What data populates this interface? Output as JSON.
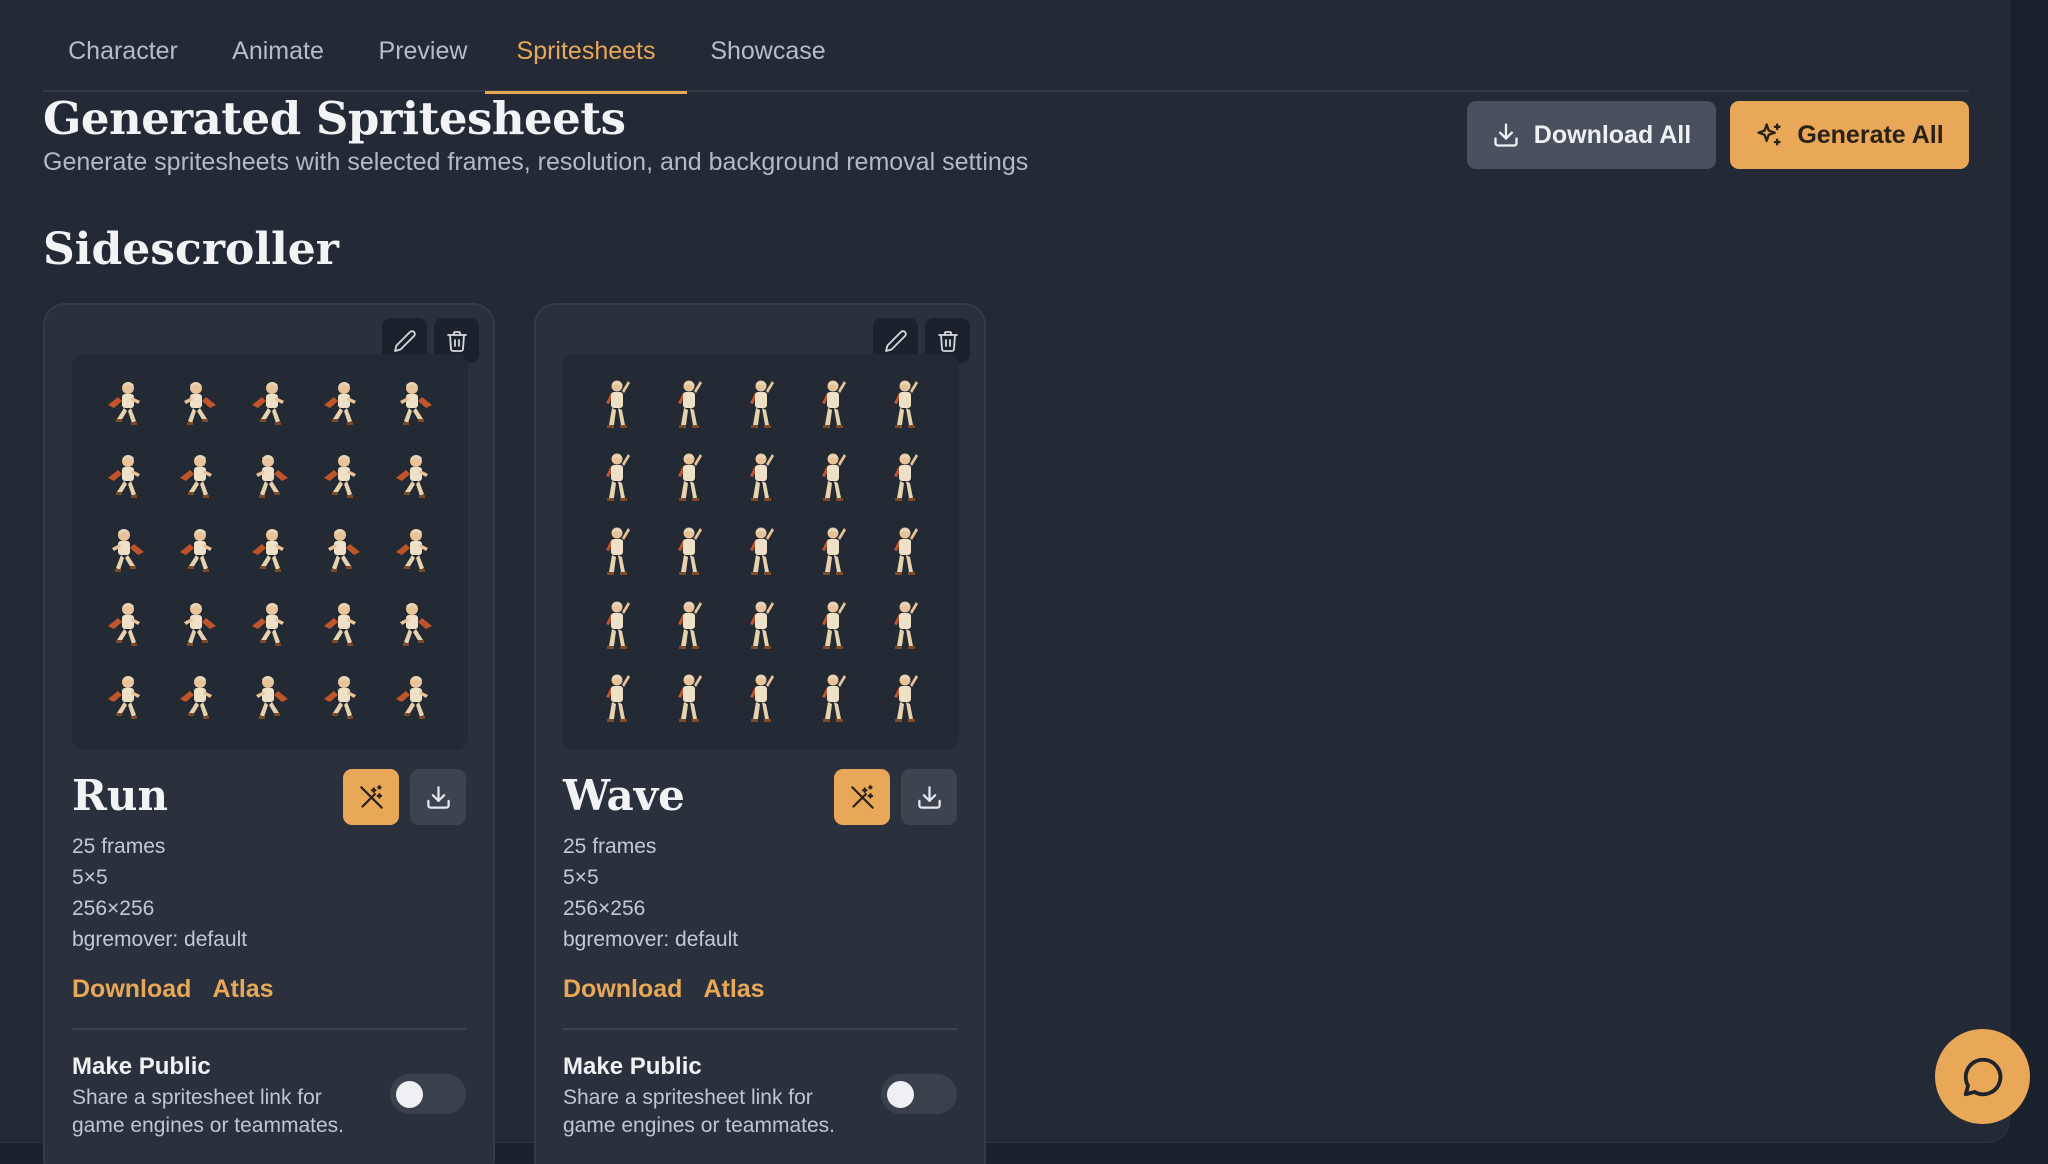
{
  "tabs": [
    {
      "label": "Character",
      "active": false
    },
    {
      "label": "Animate",
      "active": false
    },
    {
      "label": "Preview",
      "active": false
    },
    {
      "label": "Spritesheets",
      "active": true
    },
    {
      "label": "Showcase",
      "active": false
    }
  ],
  "header": {
    "title": "Generated Spritesheets",
    "subtitle": "Generate spritesheets with selected frames, resolution, and background removal settings",
    "download_all_label": "Download All",
    "download_all_icon": "download-icon",
    "generate_all_label": "Generate All",
    "generate_all_icon": "sparkles-icon"
  },
  "section": {
    "title": "Sidescroller"
  },
  "cards": [
    {
      "name": "Run",
      "frames": "25 frames",
      "grid": "5×5",
      "resolution": "256×256",
      "bgremover": "bgremover: default",
      "download_label": "Download",
      "atlas_label": "Atlas",
      "public_title": "Make Public",
      "public_desc": "Share a spritesheet link for game engines or teammates.",
      "is_public": false,
      "pose": "run"
    },
    {
      "name": "Wave",
      "frames": "25 frames",
      "grid": "5×5",
      "resolution": "256×256",
      "bgremover": "bgremover: default",
      "download_label": "Download",
      "atlas_label": "Atlas",
      "public_title": "Make Public",
      "public_desc": "Share a spritesheet link for game engines or teammates.",
      "is_public": false,
      "pose": "wave"
    }
  ],
  "colors": {
    "accent": "#e8a857",
    "background": "#1b212b",
    "panel": "#232a35",
    "card": "#2a313d"
  },
  "chat": {
    "icon": "chat-bubble-icon"
  }
}
